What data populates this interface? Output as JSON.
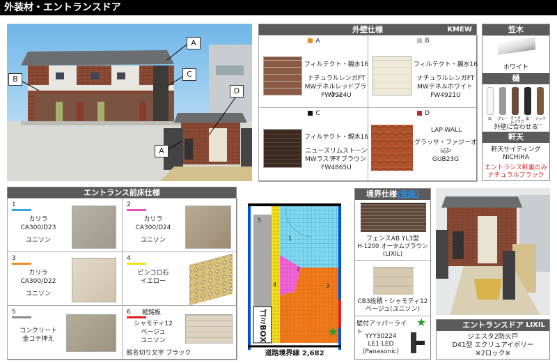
{
  "title": "外装材・エントランスドア",
  "photo_callouts": [
    "A",
    "B",
    "C",
    "D",
    "A"
  ],
  "wall": {
    "header": "外壁仕様",
    "code": "KMEW",
    "items": [
      {
        "key": "A",
        "color": "#f08c2a",
        "maker": "フィルテクト・親水16",
        "name1": "ナチュラルレンガFT",
        "name2": "MWテネルレッドブラウン",
        "code": "FW4924U"
      },
      {
        "key": "B",
        "color": "#bdbdbd",
        "maker": "フィルテクト・親水16",
        "name1": "ナチュラルレンガFT",
        "name2": "MWテネルホワイト",
        "code": "FW4921U"
      },
      {
        "key": "C",
        "color": "#111111",
        "maker": "フィルテクト・親水16",
        "name1": "ニュースリムストーンFT",
        "name2": "MWラスティブラウン",
        "code": "FW4865U"
      },
      {
        "key": "D",
        "color": "#c0262d",
        "maker": "LAP-WALL",
        "name1": "グラッサ・ファジーオレン",
        "name2": "ジ",
        "code": "GUB23G"
      }
    ]
  },
  "side": {
    "kasagi_header": "笠木",
    "kasagi_color": "ホワイト",
    "toi_header": "樋",
    "toi_colors": [
      "白",
      "グレー",
      "オータムブラウン",
      "黒",
      "ナッティー"
    ],
    "toi_note": "外壁に合わせる",
    "nokiten_header": "軒天",
    "nokiten_product": "軒天サイディング",
    "nokiten_maker": "NICHIHA",
    "nokiten_note1": "エントランス軒裏のみ",
    "nokiten_note2": "ナチュラルブラック"
  },
  "floor": {
    "header": "エントランス前床仕様",
    "items": [
      {
        "num": "1",
        "bar": "#35a8e0",
        "line1": "カリラ",
        "line2": "CA300/D23",
        "line3": "ユニソン"
      },
      {
        "num": "2",
        "bar": "#e84fc5",
        "line1": "カリラ",
        "line2": "CA300/D24",
        "line3": "ユニソン"
      },
      {
        "num": "3",
        "bar": "#f08c2a",
        "line1": "カリラ",
        "line2": "CA300/D22",
        "line3": "ユニソン"
      },
      {
        "num": "4",
        "bar": "#f5e11b",
        "line1": "ピンコロ石",
        "line2": "イエロー",
        "line3": ""
      },
      {
        "num": "5",
        "bar": "#8a8a8a",
        "line1": "コンクリート",
        "line2": "金コテ押え",
        "line3": ""
      },
      {
        "num": "6",
        "bar": "#e02020",
        "line1": "館銘板",
        "line2": "シャモティ12",
        "line3": "ベージュ",
        "line4": "ユニソン",
        "line5": "館名切り文字 ブラック"
      }
    ]
  },
  "plan": {
    "box_label": "ゴミBOX",
    "boundary": "道路境界線 2,682",
    "regions": [
      "5",
      "1",
      "2",
      "3",
      "4"
    ]
  },
  "boundary": {
    "header": "境界仕様",
    "header_tag": "(青線)",
    "fence1": "フェンスAB YL3型",
    "fence2": "H-1200 オータムブラウン",
    "fence3": "(LIXIL)",
    "block1": "CB3段積・シャモティ12",
    "block2": "ベージュ(ユニソン)",
    "light_title": "壁付アッパーライト",
    "light1": "YYY30224",
    "light2": "LE1 LED",
    "light3": "(Panasonic)"
  },
  "door": {
    "header": "エントランスドア",
    "maker": "LIXIL",
    "line1": "ジエスタ2防火戸",
    "line2": "D41型 エクリュアイボリー",
    "line3": "※2ロック※"
  }
}
